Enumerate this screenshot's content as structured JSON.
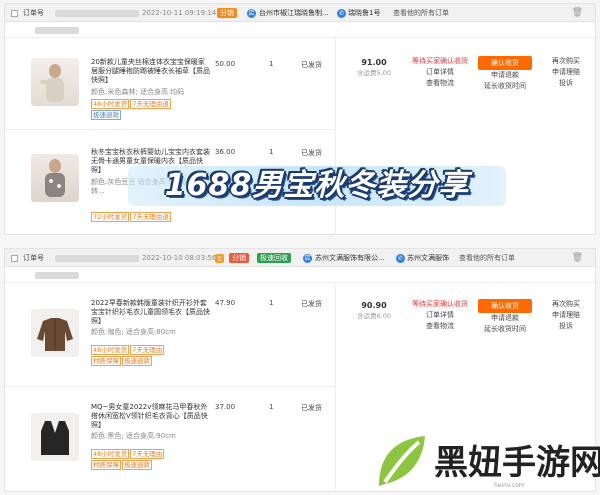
{
  "order1": {
    "order_label": "订单号",
    "time": "2022-10-11 09:19:14",
    "tag": "分销",
    "shop": "台州市椒江瑞晓鲁制...",
    "chat": "瑞晓鲁1号",
    "view_all": "查看他的所有订单",
    "items": [
      {
        "title": "20新款儿童夹丝棉连体衣宝宝保暖家居服分腿睡袍防踢被睡衣长袖草【质品快照】",
        "attr": "颜色:米色森林; 适合身高:均码",
        "badges": [
          "48小时发货",
          "7天无理由退",
          "极速退款"
        ],
        "price": "50.00",
        "qty": "1",
        "status": "已发货"
      },
      {
        "title": "秋冬宝宝秋衣秋裤婴幼儿宝宝内衣套装无骨卡通男童女童保暖内衣【质品快照】",
        "attr": "颜色:灰色豆豆 适合身高:90 码 (可开转...",
        "badges": [
          "72小时发货",
          "7天无理由退"
        ],
        "price": "36.00",
        "qty": "1",
        "status": "已发货"
      }
    ],
    "amount": "91.00",
    "shipping": "含运费5.00",
    "status_lines": [
      "等待买家确认收货",
      "订单详情",
      "查看物流"
    ],
    "action_button": "确认收货",
    "action_links": [
      "申请退款",
      "延长收货时间"
    ],
    "more_links": [
      "再次购买",
      "申请理赔",
      "投诉"
    ]
  },
  "order2": {
    "order_label": "订单号",
    "time": "2022-10-10 08:03:56",
    "tags": [
      "分销",
      "极速回收"
    ],
    "shop": "苏州文满服饰有限公...",
    "chat": "苏州文满服饰",
    "view_all": "查看他的所有订单",
    "items": [
      {
        "title": "2022早春新款韩版童装针织开衫外套 宝宝针织衫毛衣儿童圆领毛衣【质品快照】",
        "attr": "颜色:咖色; 适合身高:80cm",
        "badges": [
          "48小时发货",
          "7天无理由",
          "材质保障",
          "极速退款"
        ],
        "price": "47.90",
        "qty": "1",
        "status": "已发货"
      },
      {
        "title": "MQ~男女童2022v领麻花马甲春秋外搭休闲宽松V领针织毛衣背心【质品快照】",
        "attr": "颜色:黑色; 适合身高:90cm",
        "badges": [
          "48小时发货",
          "7天无理由",
          "材质保障",
          "极速退款"
        ],
        "price": "37.00",
        "qty": "1",
        "status": "已发货"
      }
    ],
    "amount": "90.90",
    "shipping": "含运费6.00",
    "status_lines": [
      "等待买家确认收货",
      "订单详情",
      "查看物流"
    ],
    "action_button": "确认收货",
    "action_links": [
      "申请退款",
      "延长收货时间"
    ],
    "more_links": [
      "再次购买",
      "申请理赔",
      "投诉"
    ]
  },
  "overlay_title": "1688男宝秋冬装分享",
  "watermark": {
    "text": "黑妞手游网",
    "url": "heinv.com",
    "color": "#8cc63f"
  },
  "icons": {
    "delete": "trash-icon",
    "shop": "shop-icon",
    "chat": "chat-icon"
  }
}
